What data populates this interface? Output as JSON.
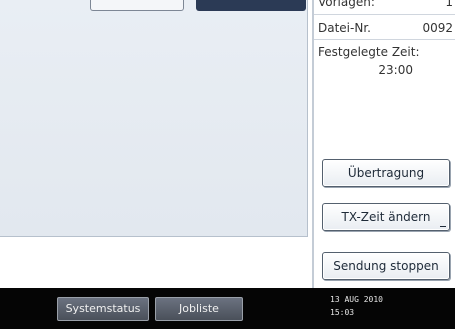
{
  "info": {
    "originals_label": "Vorlagen:",
    "originals_value": "1",
    "file_no_label": "Datei-Nr.",
    "file_no_value": "0092",
    "scheduled_label": "Festgelegte Zeit:",
    "scheduled_value": "23:00"
  },
  "actions": {
    "transmission": "Übertragung",
    "change_tx_time": "TX-Zeit ändern",
    "stop_sending": "Sendung stoppen"
  },
  "taskbar": {
    "system_status": "Systemstatus",
    "job_list": "Jobliste",
    "date": "13 AUG  2010",
    "time": "15:03"
  },
  "colors": {
    "bar_background": "#050505",
    "panel_background": "#e6ebf1",
    "button_border": "#54606e"
  }
}
